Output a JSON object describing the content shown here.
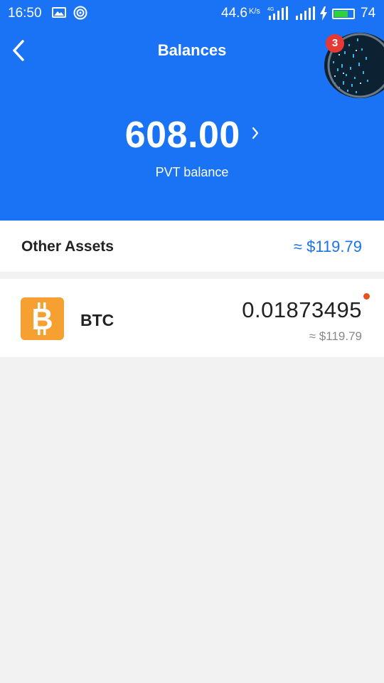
{
  "status_bar": {
    "time": "16:50",
    "net_speed": "44.6",
    "net_speed_unit": "K/s",
    "network_type": "4G",
    "battery_percent": "74",
    "battery_level": 0.74
  },
  "header": {
    "title": "Balances",
    "notification_count": "3",
    "balance_amount": "608.00",
    "balance_label": "PVT balance",
    "accent_color": "#1a73f5"
  },
  "other_assets": {
    "title": "Other Assets",
    "total": "≈ $119.79"
  },
  "assets": [
    {
      "symbol": "BTC",
      "icon": "bitcoin-icon",
      "amount": "0.01873495",
      "fiat": "≈ $119.79",
      "has_update_dot": true
    }
  ]
}
